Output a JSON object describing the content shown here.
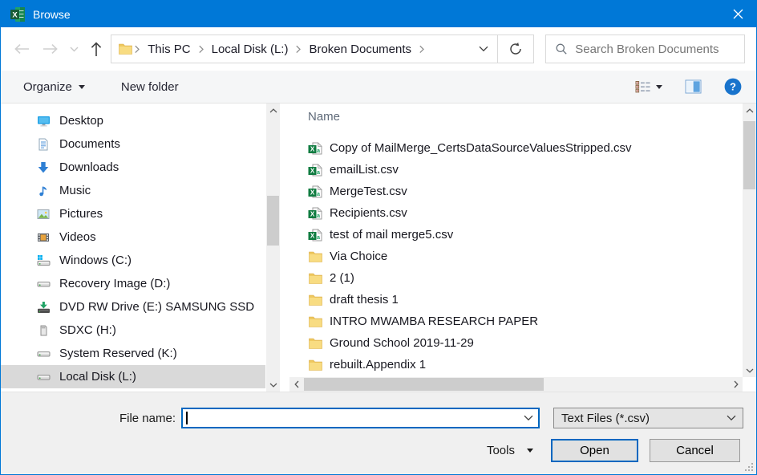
{
  "window": {
    "title": "Browse"
  },
  "nav": {
    "breadcrumb": [
      {
        "label": "This PC"
      },
      {
        "label": "Local Disk (L:)"
      },
      {
        "label": "Broken Documents"
      }
    ],
    "search_placeholder": "Search Broken Documents"
  },
  "toolbar": {
    "organize": "Organize",
    "new_folder": "New folder"
  },
  "sidebar": {
    "items": [
      {
        "icon": "desktop-icon",
        "label": "Desktop"
      },
      {
        "icon": "documents-icon",
        "label": "Documents"
      },
      {
        "icon": "downloads-icon",
        "label": "Downloads"
      },
      {
        "icon": "music-icon",
        "label": "Music"
      },
      {
        "icon": "pictures-icon",
        "label": "Pictures"
      },
      {
        "icon": "videos-icon",
        "label": "Videos"
      },
      {
        "icon": "windows-drive-icon",
        "label": "Windows (C:)"
      },
      {
        "icon": "drive-icon",
        "label": "Recovery Image (D:)"
      },
      {
        "icon": "dvd-drive-icon",
        "label": "DVD RW Drive (E:) SAMSUNG SSD"
      },
      {
        "icon": "sd-card-icon",
        "label": "SDXC (H:)"
      },
      {
        "icon": "drive-icon",
        "label": "System Reserved (K:)"
      },
      {
        "icon": "drive-icon",
        "label": "Local Disk (L:)",
        "selected": true
      }
    ]
  },
  "file_list": {
    "name_header": "Name",
    "items": [
      {
        "icon": "csv-file-icon",
        "label": "Copy of MailMerge_CertsDataSourceValuesStripped.csv"
      },
      {
        "icon": "csv-file-icon",
        "label": "emailList.csv"
      },
      {
        "icon": "csv-file-icon",
        "label": "MergeTest.csv"
      },
      {
        "icon": "csv-file-icon",
        "label": "Recipients.csv"
      },
      {
        "icon": "csv-file-icon",
        "label": "test of mail merge5.csv"
      },
      {
        "icon": "folder-icon",
        "label": "Via Choice"
      },
      {
        "icon": "folder-icon",
        "label": "2 (1)"
      },
      {
        "icon": "folder-icon",
        "label": "draft thesis 1"
      },
      {
        "icon": "folder-icon",
        "label": "INTRO MWAMBA RESEARCH PAPER"
      },
      {
        "icon": "folder-icon",
        "label": "Ground School 2019-11-29"
      },
      {
        "icon": "folder-icon",
        "label": "rebuilt.Appendix 1"
      }
    ]
  },
  "footer": {
    "file_name_label": "File name:",
    "file_name_value": "",
    "file_type_value": "Text Files (*.csv)",
    "tools_label": "Tools",
    "open_label": "Open",
    "cancel_label": "Cancel"
  },
  "colors": {
    "accent": "#0078d7",
    "excel_green": "#107c41",
    "selection_gray": "#d9d9d9",
    "scrollbar_thumb": "#cdcdcd"
  }
}
